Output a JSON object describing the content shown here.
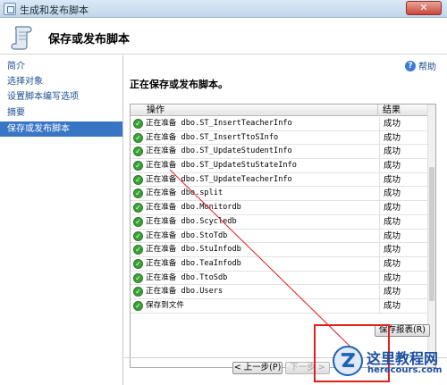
{
  "window": {
    "title": "生成和发布脚本",
    "close_label": "✕"
  },
  "header": {
    "title": "保存或发布脚本"
  },
  "sidebar": {
    "items": [
      {
        "label": "简介"
      },
      {
        "label": "选择对象"
      },
      {
        "label": "设置脚本编写选项"
      },
      {
        "label": "摘要"
      },
      {
        "label": "保存或发布脚本",
        "active": true
      }
    ]
  },
  "main": {
    "help_label": "帮助",
    "heading": "正在保存或发布脚本。",
    "grid": {
      "columns": [
        "操作",
        "结果"
      ],
      "rows": [
        {
          "op": "正在准备 dbo.ST_InsertTeacherInfo",
          "result": "成功"
        },
        {
          "op": "正在准备 dbo.ST_InsertTtoSInfo",
          "result": "成功"
        },
        {
          "op": "正在准备 dbo.ST_UpdateStudentInfo",
          "result": "成功"
        },
        {
          "op": "正在准备 dbo.ST_UpdateStuStateInfo",
          "result": "成功"
        },
        {
          "op": "正在准备 dbo.ST_UpdateTeacherInfo",
          "result": "成功"
        },
        {
          "op": "正在准备 dbo.split",
          "result": "成功"
        },
        {
          "op": "正在准备 dbo.Monitordb",
          "result": "成功"
        },
        {
          "op": "正在准备 dbo.Scycledb",
          "result": "成功"
        },
        {
          "op": "正在准备 dbo.StoTdb",
          "result": "成功"
        },
        {
          "op": "正在准备 dbo.StuInfodb",
          "result": "成功"
        },
        {
          "op": "正在准备 dbo.TeaInfodb",
          "result": "成功"
        },
        {
          "op": "正在准备 dbo.TtoSdb",
          "result": "成功"
        },
        {
          "op": "正在准备 dbo.Users",
          "result": "成功"
        },
        {
          "op": "保存到文件",
          "result": "成功"
        }
      ]
    },
    "save_report_label": "保存报表(R)",
    "prev_label": "< 上一步(P)",
    "next_label": "下一步 >"
  },
  "watermark": {
    "text": "这里教程网",
    "url": "herecours.com"
  },
  "colors": {
    "accent": "#3875c4",
    "annotation": "#e0201c",
    "success": "#3aa335"
  }
}
